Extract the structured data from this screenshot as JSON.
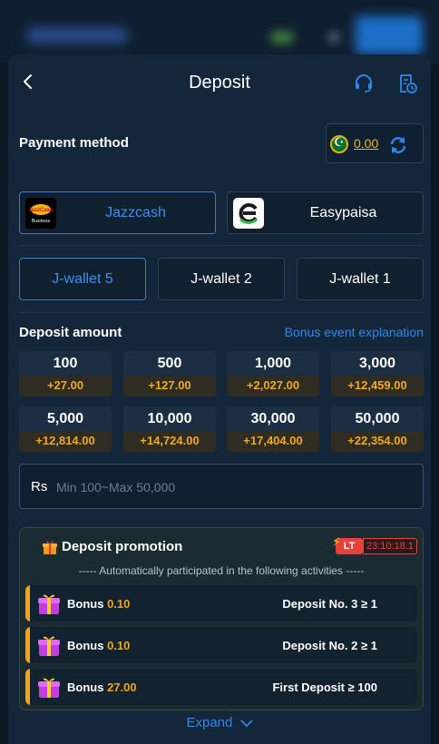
{
  "header": {
    "title": "Deposit"
  },
  "payment": {
    "label": "Payment method",
    "balance": "0.00",
    "methods": [
      {
        "name": "Jazzcash",
        "logo": "jazzcash-logo",
        "logo_text_1": "JazzCash",
        "logo_text_2": "Business"
      },
      {
        "name": "Easypaisa",
        "logo": "easypaisa-logo"
      }
    ],
    "wallets": [
      "J-wallet 5",
      "J-wallet 2",
      "J-wallet 1"
    ]
  },
  "deposit": {
    "label": "Deposit amount",
    "bonus_link": "Bonus event explanation",
    "amounts": [
      {
        "value": "100",
        "bonus": "+27.00"
      },
      {
        "value": "500",
        "bonus": "+127.00"
      },
      {
        "value": "1,000",
        "bonus": "+2,027.00"
      },
      {
        "value": "3,000",
        "bonus": "+12,459.00"
      },
      {
        "value": "5,000",
        "bonus": "+12,814.00"
      },
      {
        "value": "10,000",
        "bonus": "+14,724.00"
      },
      {
        "value": "30,000",
        "bonus": "+17,404.00"
      },
      {
        "value": "50,000",
        "bonus": "+22,354.00"
      }
    ],
    "currency": "Rs",
    "placeholder": "Min 100~Max 50,000"
  },
  "promo": {
    "title": "Deposit promotion",
    "badge": "LT",
    "timer": "23:10:18.1",
    "subtitle": "----- Automatically participated in the following activities -----",
    "rows": [
      {
        "label": "Bonus",
        "value": "0.10",
        "condition": "Deposit No. 3 ≥ 1"
      },
      {
        "label": "Bonus",
        "value": "0.10",
        "condition": "Deposit No. 2 ≥ 1"
      },
      {
        "label": "Bonus",
        "value": "27.00",
        "condition": "First Deposit ≥ 100"
      }
    ],
    "expand": "Expand"
  },
  "colors": {
    "accent": "#2f88ec",
    "bonus": "#f4a41a",
    "panel": "#14273a"
  }
}
